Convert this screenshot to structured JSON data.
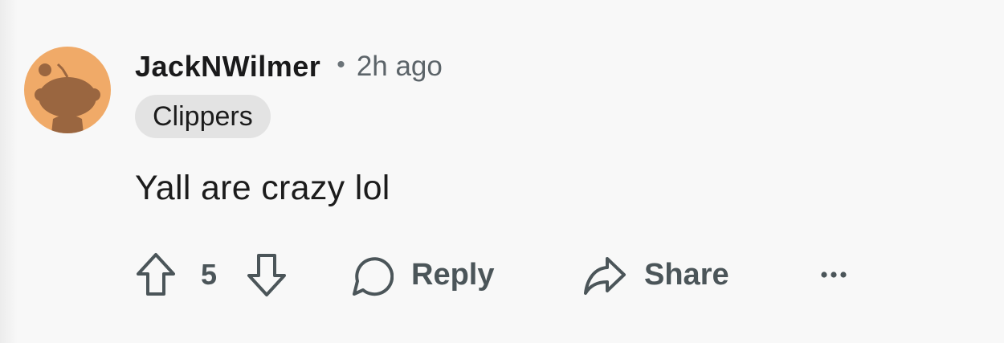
{
  "comment": {
    "username": "JackNWilmer",
    "separator": "•",
    "timestamp": "2h ago",
    "flair": "Clippers",
    "body": "Yall are crazy lol",
    "vote_count": "5",
    "reply_label": "Reply",
    "share_label": "Share"
  },
  "colors": {
    "background": "#f8f8f8",
    "avatar_bg": "#f0aa68",
    "avatar_figure": "#9a6640",
    "flair_bg": "#e3e3e3",
    "action_gray": "#4b5559"
  },
  "icons": {
    "avatar": "snoo-avatar-icon",
    "upvote": "arrow-up-outline-icon",
    "downvote": "arrow-down-outline-icon",
    "reply": "speech-bubble-icon",
    "share": "share-arrow-icon",
    "more": "ellipsis-icon"
  }
}
